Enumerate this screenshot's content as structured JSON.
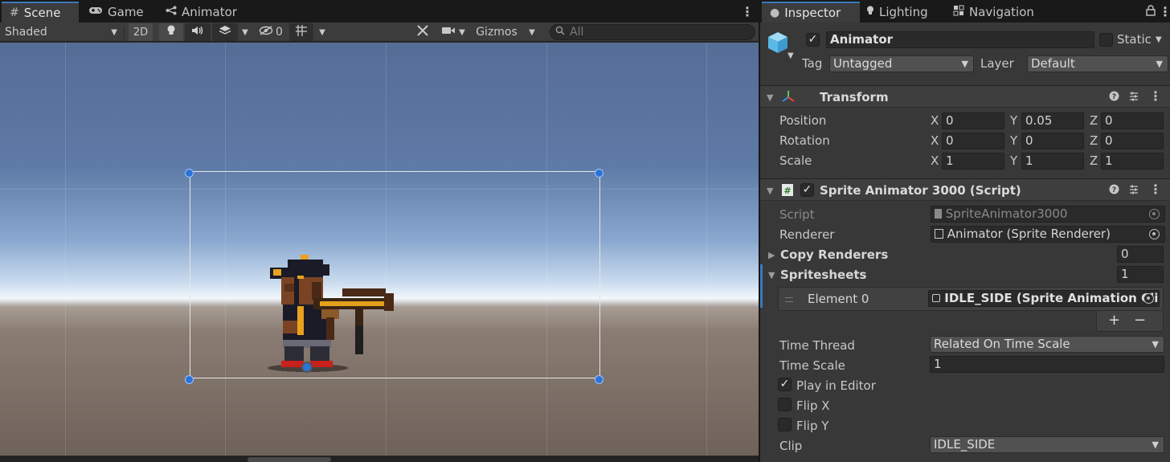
{
  "scene_tabs": [
    {
      "label": "Scene",
      "icon": "grid-icon",
      "active": true
    },
    {
      "label": "Game",
      "icon": "gamepad-icon",
      "active": false
    },
    {
      "label": "Animator",
      "icon": "animator-icon",
      "active": false
    }
  ],
  "scene_toolbar": {
    "draw_mode": "Shaded",
    "mode_2d": "2D",
    "hidden_count": "0",
    "gizmos": "Gizmos",
    "search_placeholder": "All"
  },
  "inspector_tabs": [
    {
      "label": "Inspector",
      "icon": "info-icon",
      "active": true
    },
    {
      "label": "Lighting",
      "icon": "bulb-icon",
      "active": false
    },
    {
      "label": "Navigation",
      "icon": "navigation-icon",
      "active": false
    }
  ],
  "gameobject": {
    "name": "Animator",
    "active": true,
    "static_label": "Static",
    "tag_label": "Tag",
    "tag_value": "Untagged",
    "layer_label": "Layer",
    "layer_value": "Default"
  },
  "transform": {
    "title": "Transform",
    "rows": [
      {
        "label": "Position",
        "x": "0",
        "y": "0.05",
        "z": "0"
      },
      {
        "label": "Rotation",
        "x": "0",
        "y": "0",
        "z": "0"
      },
      {
        "label": "Scale",
        "x": "1",
        "y": "1",
        "z": "1"
      }
    ],
    "axis_x": "X",
    "axis_y": "Y",
    "axis_z": "Z"
  },
  "sprite_animator": {
    "title": "Sprite Animator 3000 (Script)",
    "enabled": true,
    "script_label": "Script",
    "script_value": "SpriteAnimator3000",
    "renderer_label": "Renderer",
    "renderer_value": "Animator (Sprite Renderer)",
    "copy_renderers_label": "Copy Renderers",
    "copy_renderers_count": "0",
    "spritesheets_label": "Spritesheets",
    "spritesheets_count": "1",
    "element0_label": "Element 0",
    "element0_value": "IDLE_SIDE (Sprite Animation Clip",
    "add_label": "+",
    "remove_label": "−",
    "time_thread_label": "Time Thread",
    "time_thread_value": "Related On Time Scale",
    "time_scale_label": "Time Scale",
    "time_scale_value": "1",
    "play_in_editor_label": "Play in Editor",
    "play_in_editor": true,
    "flip_x_label": "Flip X",
    "flip_x": false,
    "flip_y_label": "Flip Y",
    "flip_y": false,
    "clip_label": "Clip",
    "clip_value": "IDLE_SIDE"
  },
  "colors": {
    "accent": "#3a79bb",
    "handle": "#2c73d6",
    "panel": "#383838"
  }
}
